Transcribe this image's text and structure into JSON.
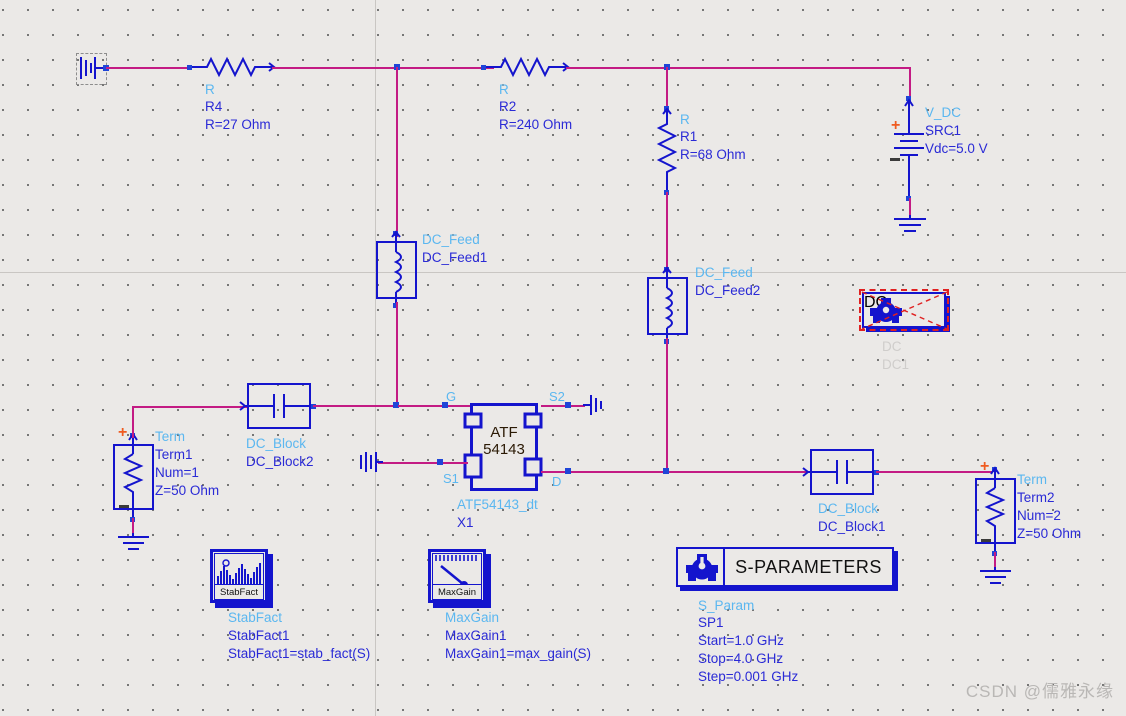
{
  "app": {
    "kind": "schematic-editor",
    "background": "#ebe9e7",
    "wire_color": "#c31b84",
    "component_color": "#1414cd",
    "type_label_color": "#5bb7f0",
    "value_label_color": "#2a2ad6",
    "disabled_color": "#cfcdcb"
  },
  "components": {
    "r4": {
      "type": "R",
      "name": "R4",
      "value": "R=27 Ohm"
    },
    "r2": {
      "type": "R",
      "name": "R2",
      "value": "R=240 Ohm"
    },
    "r1": {
      "type": "R",
      "name": "R1",
      "value": "R=68 Ohm"
    },
    "src1": {
      "type": "V_DC",
      "name": "SRC1",
      "value": "Vdc=5.0 V",
      "plus": "+",
      "minus": "_"
    },
    "dc_feed1": {
      "type": "DC_Feed",
      "name": "DC_Feed1"
    },
    "dc_feed2": {
      "type": "DC_Feed",
      "name": "DC_Feed2"
    },
    "dc_block2": {
      "type": "DC_Block",
      "name": "DC_Block2"
    },
    "dc_block1": {
      "type": "DC_Block",
      "name": "DC_Block1"
    },
    "term1": {
      "type": "Term",
      "name": "Term1",
      "num": "Num=1",
      "z": "Z=50 Ohm",
      "plus": "+",
      "minus": "_"
    },
    "term2": {
      "type": "Term",
      "name": "Term2",
      "num": "Num=2",
      "z": "Z=50 Ohm",
      "plus": "+",
      "minus": "_"
    },
    "transistor": {
      "part_line1": "ATF",
      "part_line2": "54143",
      "model": "ATF54143_dt",
      "instance": "X1",
      "pins": {
        "g": "G",
        "s1": "S1",
        "s2": "S2",
        "d": "D"
      }
    }
  },
  "sim_blocks": {
    "stabfact": {
      "icon_caption": "StabFact",
      "type": "StabFact",
      "name": "StabFact1",
      "expr": "StabFact1=stab_fact(S)"
    },
    "maxgain": {
      "icon_caption": "MaxGain",
      "type": "MaxGain",
      "name": "MaxGain1",
      "expr": "MaxGain1=max_gain(S)"
    },
    "sparams": {
      "title": "S-PARAMETERS",
      "type": "S_Param",
      "name": "SP1",
      "start": "Start=1.0 GHz",
      "stop": "Stop=4.0 GHz",
      "step": "Step=0.001 GHz"
    },
    "dc": {
      "title": "DC",
      "type": "DC",
      "name": "DC1",
      "enabled": false
    }
  },
  "watermark": {
    "text": "CSDN @儒雅永缘"
  }
}
